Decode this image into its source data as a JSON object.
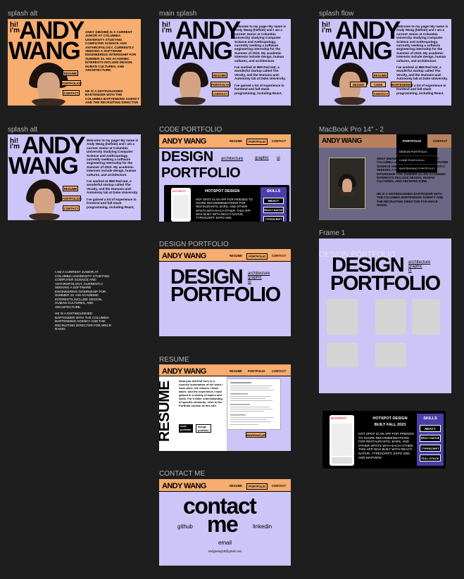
{
  "frames": {
    "splash_alt_1": "splash alt",
    "main_splash": "main splash",
    "splash_flow": "splash flow",
    "splash_alt_2": "splash alt",
    "code_portfolio": "CODE PORTFOLIO",
    "macbook": "MacBook Pro 14\" - 2",
    "design_portfolio": "DESIGN PORTFOLIO",
    "frame1": "Frame 1",
    "resume": "RESUME",
    "contact": "CONTACT ME"
  },
  "splash": {
    "hi": "hi!\ni'm",
    "name1": "ANDY",
    "name2": "WANG",
    "bio_caps": "ANDY (HE/HIM) IS A CURRENT JUNIOR AT COLUMBIA UNIVERSITY STUDYING COMPUTER SCIENCE AND ANTHROPOLOGY, CURRENTLY SEEKING A SOFTWARE ENGINEERING INTERNSHIP FOR SUMMER 23. HIS ACADEMIC INTERESTS INCLUDE DESIGN, HUMAN CULTURES, AND ARCHITECTURE.",
    "bio_caps2": "HE IS A DISTINGUISHED BARTENDER WITH THE COLUMBIA BARTENDING AGENCY AND THE RECRUITING DIRECTOR FOR WKCR RADIO.",
    "welcome_p1": "Welcome to my page! My name is Andy Wang (he/him) and I am a current Junior at Columbia University studying Computer Science and Anthropology, currently seeking a software engineering internship for the Summer of 2023. My academic interests include design, human cultures, and architecture.",
    "welcome_p2": "I've worked at IBM Red Hat, a wonderful startup called The Veraity, and the Humans-and-Autonomy lab at Duke University.",
    "welcome_p3": "I've gained a lot of experience in frontend and full-stack programming, including React,",
    "btn_resume": "RESUME",
    "btn_portfolios": "PORTFOLIOS",
    "btn_contact": "CONTACT",
    "btn_design": "DESIGN",
    "btn_code": "CODE",
    "btn_bartending": "BARTENDING"
  },
  "nav": {
    "logo": "ANDY WANG",
    "resume": "RESUME",
    "portfolio": "PORTFOLIO",
    "contact": "CONTACT"
  },
  "code": {
    "title1": "DESIGN",
    "title2": "PORTFOLIO",
    "tab_arch": "architecture",
    "tab_graphic": "graphic",
    "tab_ui": "ui",
    "project_title": "HOTSPOT DESIGN",
    "project_desc": "HOT SPOT IS AN APP FOR FRIENDS TO SHARE RECOMMENDATIONS FOR RESTAURANTS, BARS, AND OTHER SPOTS WITH EACH OTHER. THIS APP WAS BUILT WITH REACT-NATIVE, TYPESCRIPT, EXPO SDK",
    "skills": "SKILLS",
    "skill1": "REACT",
    "skill2": "REACT-NATIVE",
    "skill3": "TYPESCRIPT"
  },
  "macbook": {
    "logo": "ANDY WANG",
    "portfolio": "PORTFOLIO",
    "contact": "CONTACT",
    "menu": [
      "DESIGN PORTFOLIO",
      "CODE PORTFOLIO",
      "BARTENDING PORTFOLIO"
    ],
    "bio1": "ANDY (HE/HIM) IS A CURRENT JUNIOR AT COLUMBIA UNIVERSITY STUDYING COMPUTER SCIENCE AND ANTHROPOLOGY, CURRENTLY SEEKING A SOFTWARE ENGINEERING INTERNSHIP FOR SUMMER 23. HIS ACADEMIC INTERESTS INCLUDE DESIGN, HUMAN CULTURES, AND ARCHITECTURE.",
    "bio2": "HE IS A DISTINGUISHED BARTENDER WITH THE COLUMBIA BARTENDING AGENCY AND THE RECRUITING DIRECTOR FOR WKCR RADIO."
  },
  "loose_bio": {
    "p1": "I am A CURRENT JUNIOR AT COLUMBIA UNIVERSITY STUDYING COMPUTER SCIENCE AND ANTHROPOLOGY, CURRENTLY SEEKING A SOFTWARE ENGINEERING INTERNSHIP FOR SUMMER 23. HIS ACADEMIC INTERESTS INCLUDE DESIGN, HUMAN CULTURES, AND ARCHITECTURE.",
    "p2": "HE IS A DISTINGUISHED BARTENDER WITH THE COLUMBIA BARTENDING AGENCY AND THE RECRUITING DIRECTOR FOR WKCR RADIO."
  },
  "design": {
    "title1": "DESIGN",
    "title2": "PORTFOLIO",
    "tab_arch": "architecture",
    "tab_graphic": "graphic",
    "tab_ui": "ui",
    "ghost": "DESIGN PORTFOLIO"
  },
  "hotspot_card": {
    "title": "HOTSPOT DESIGN",
    "date": "BUILT FALL 2023",
    "desc": "HOT SPOT IS AN APP FOR FRIENDS TO SHARE RECOMMENDATIONS FOR RESTAURANTS, BARS, AND OTHER SPOTS WITH EACH OTHER. THIS APP WAS BUILT WITH REACT-NATIVE, TYPESCRIPT, EXPO SDK, AND MAPVIEW.",
    "skills": "SKILLS",
    "skill1": "REACT",
    "skill2": "REACT-NATIVE",
    "skill3": "TYPESCRIPT",
    "skill4": "FULL-STACK",
    "app_name": "HOTSPOT"
  },
  "resume": {
    "vertical": "RESUME",
    "blurb": "what you will find here is a concise summation of the work I have done, the classes I have taken, and the experience I have gained in a variety of topics and skills. For a fuller understanding of specific elements, refer to the Portfolio section of this site.",
    "code_tab": "code portfolio",
    "design_tab": "design portfolio",
    "download": "download pdf"
  },
  "contact": {
    "title1": "contact",
    "title2": "me",
    "github": "github",
    "linkedin": "linkedin",
    "email": "email",
    "address": "andyjwang18@gmail.com"
  },
  "colors": {
    "canvas": "#1e1e1e",
    "orange": "#f6ad6f",
    "lavender": "#cdc4f7",
    "purple_skill": "#4a3fa8",
    "macbook_bg": "#6b6683"
  }
}
